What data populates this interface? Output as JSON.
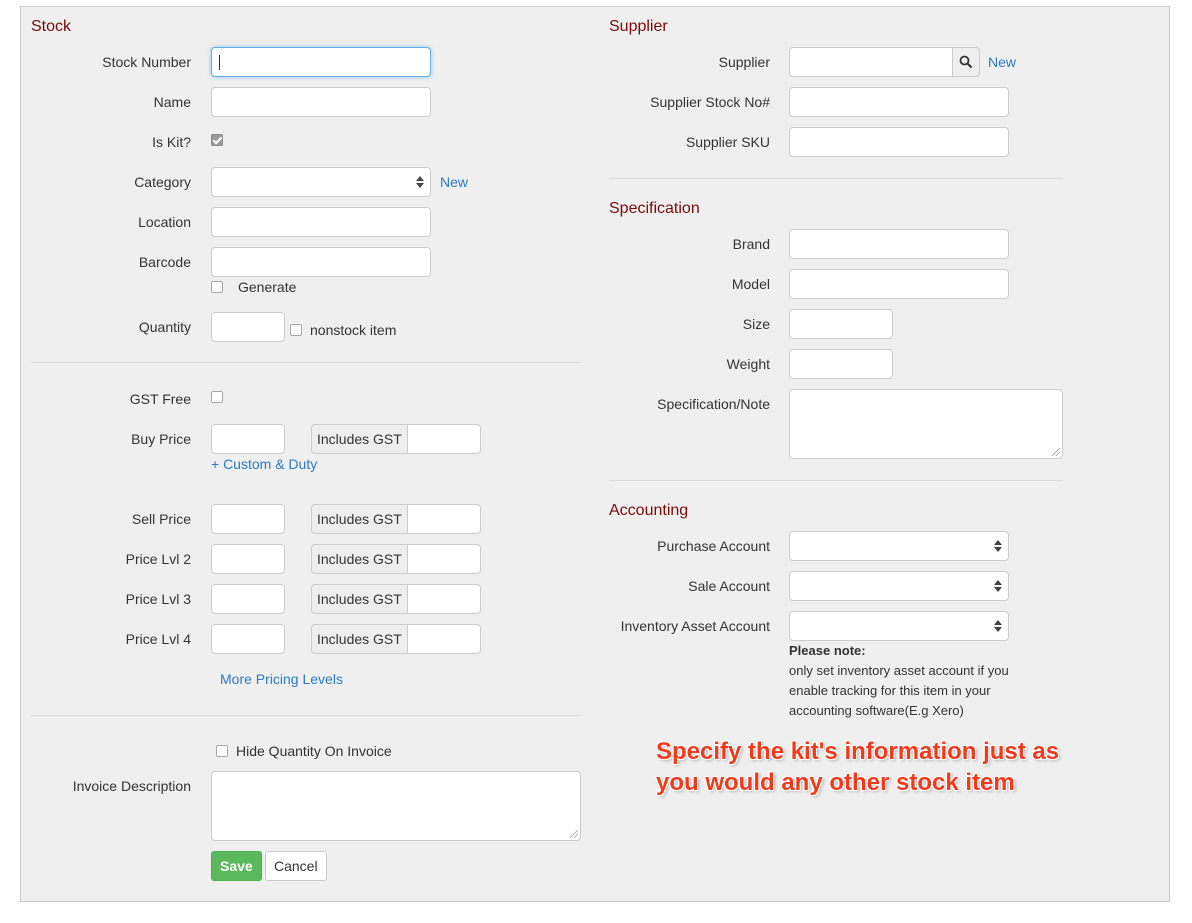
{
  "stock": {
    "heading": "Stock",
    "stock_number_label": "Stock Number",
    "name_label": "Name",
    "is_kit_label": "Is Kit?",
    "is_kit_checked": true,
    "category_label": "Category",
    "category_new": "New",
    "location_label": "Location",
    "barcode_label": "Barcode",
    "generate_label": "Generate",
    "quantity_label": "Quantity",
    "nonstock_label": "nonstock item"
  },
  "pricing": {
    "gst_free_label": "GST Free",
    "buy_price_label": "Buy Price",
    "includes_gst": "Includes GST",
    "custom_duty_link": "+ Custom & Duty",
    "sell_price_label": "Sell Price",
    "price_lvl2_label": "Price Lvl 2",
    "price_lvl3_label": "Price Lvl 3",
    "price_lvl4_label": "Price Lvl 4",
    "more_pricing_link": "More Pricing Levels"
  },
  "invoice": {
    "hide_quantity_label": "Hide Quantity On Invoice",
    "description_label": "Invoice Description",
    "save_label": "Save",
    "cancel_label": "Cancel"
  },
  "supplier": {
    "heading": "Supplier",
    "supplier_label": "Supplier",
    "new_link": "New",
    "stock_no_label": "Supplier Stock No#",
    "sku_label": "Supplier SKU"
  },
  "specification": {
    "heading": "Specification",
    "brand_label": "Brand",
    "model_label": "Model",
    "size_label": "Size",
    "weight_label": "Weight",
    "note_label": "Specification/Note"
  },
  "accounting": {
    "heading": "Accounting",
    "purchase_label": "Purchase Account",
    "sale_label": "Sale Account",
    "inventory_label": "Inventory Asset Account",
    "note_title": "Please note:",
    "note_text": "only set inventory asset account if you enable tracking for this item in your accounting software(E.g Xero)"
  },
  "callout": {
    "line1": "Specify the kit's information just as",
    "line2": "you would any other stock item"
  },
  "colors": {
    "heading": "#7a0b0b",
    "link": "#2a7bbf",
    "save_button": "#5cb85c",
    "callout": "#ef3a1c"
  }
}
